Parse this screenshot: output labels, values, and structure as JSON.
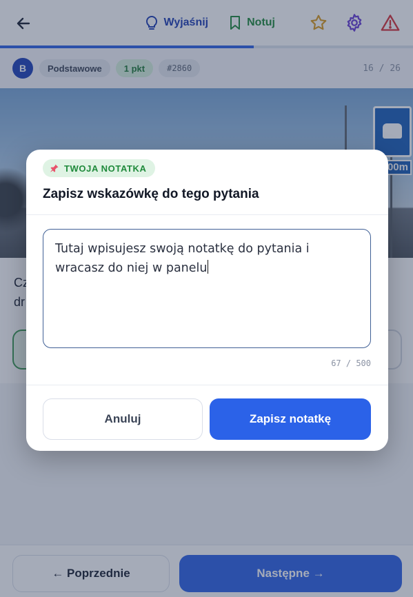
{
  "header": {
    "explain_label": "Wyjaśnij",
    "note_label": "Notuj"
  },
  "progress": {
    "fraction": 0.615
  },
  "meta": {
    "category": "B",
    "level": "Podstawowe",
    "points": "1 pkt",
    "question_id": "#2860",
    "counter": "16 / 26"
  },
  "photo": {
    "distance_plate": "00m"
  },
  "question": {
    "text_visible": "Cz\ndr"
  },
  "footer_nav": {
    "prev_label": "← Poprzednie",
    "next_label": "Następne →"
  },
  "modal": {
    "badge": "TWOJA NOTATKA",
    "title": "Zapisz wskazówkę do tego pytania",
    "note_text": "Tutaj wpisujesz swoją notatkę do pytania i wracasz do niej w panelu",
    "char_count": "67 / 500",
    "cancel_label": "Anuluj",
    "save_label": "Zapisz notatkę"
  },
  "colors": {
    "accent": "#2b62e8",
    "green": "#1f8a3b",
    "star": "#d99a1e",
    "gear": "#6a3fd6",
    "warning": "#d8333a"
  },
  "icons": [
    "back-arrow-icon",
    "lightbulb-icon",
    "bookmark-icon",
    "star-icon",
    "gear-icon",
    "warning-icon",
    "pin-icon"
  ]
}
